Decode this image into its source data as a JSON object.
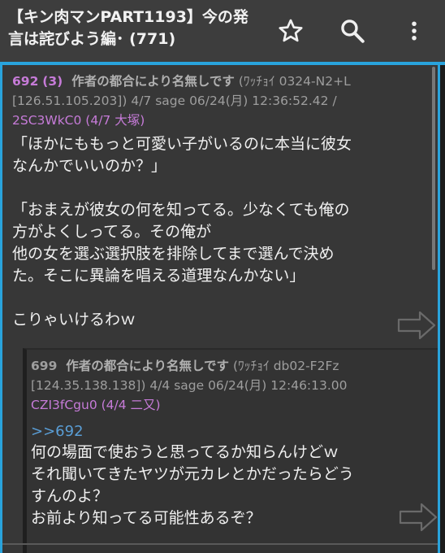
{
  "appbar": {
    "title": "【キン肉マンPART1193】今の発言は詫びよう編･ (771)",
    "star_icon": "star-outline-icon",
    "search_icon": "search-icon",
    "more_icon": "more-vert-icon"
  },
  "post": {
    "number": "692",
    "replies": "(3)",
    "name": "作者の都合により名無しです",
    "info_line1_tail": "(ﾜｯﾁｮｲ 0324-N2+L",
    "info_line2": "[126.51.105.203]) 4/7 sage 06/24(月) 12:36:52.42 /",
    "id": "2SC3WkC0 (4/7 大塚)",
    "body": "「ほかにももっと可愛い子がいるのに本当に彼女\nなんかでいいのか？」\n\n「おまえが彼女の何を知ってる。少なくても俺の\n方がよくしってる。その俺が\n他の女を選ぶ選択肢を排除してまで選んで決め\nた。そこに異論を唱える道理なんかない」\n\nこりゃいけるわｗ"
  },
  "reply": {
    "number": "699",
    "name": "作者の都合により名無しです",
    "info_line1_tail": "(ﾜｯﾁｮｲ db02-F2Fz",
    "info_line2": "[124.35.138.138]) 4/4 sage 06/24(月) 12:46:13.00",
    "id": "CZI3fCgu0 (4/4 二又)",
    "anchor": ">>692",
    "body": "何の場面で使おうと思ってるか知らんけどｗ\nそれ聞いてきたヤツが元カレとかだったらどう\nすんのよ？\nお前より知ってる可能性あるぞ？"
  },
  "colors": {
    "accent": "#29a3dc",
    "post_number": "#c67bd8",
    "id_text": "#c67bd8",
    "anchor": "#5a9ed6"
  }
}
